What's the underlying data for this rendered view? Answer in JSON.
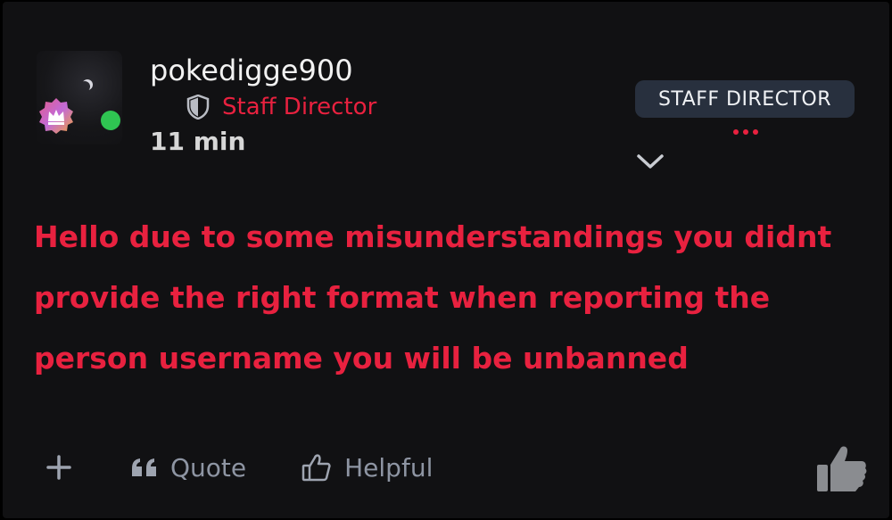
{
  "post": {
    "username": "pokedigge900",
    "role": "Staff Director",
    "time": "11 min",
    "staff_badge": "STAFF DIRECTOR",
    "message": "Hello due to some misunderstandings you didnt provide the right format when reporting the person username you will be unbanned"
  },
  "actions": {
    "quote_label": "Quote",
    "helpful_label": "Helpful"
  },
  "colors": {
    "background": "#111113",
    "accent_red": "#e8213f",
    "online_green": "#2fc452",
    "pill_bg": "#28303e",
    "muted": "#8e95a3"
  }
}
